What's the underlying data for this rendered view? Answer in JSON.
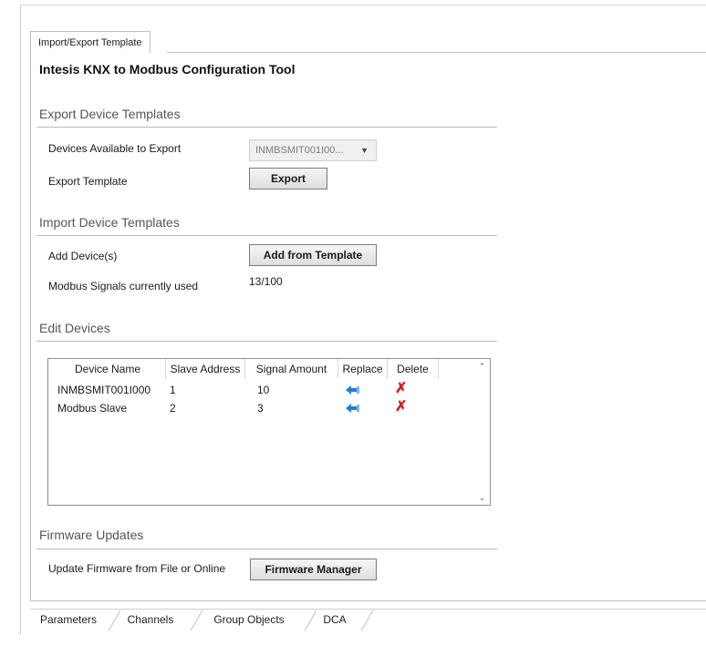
{
  "top_tab": {
    "label": "Import/Export Template"
  },
  "app_title": "Intesis KNX to Modbus Configuration Tool",
  "export_section": {
    "title": "Export Device Templates",
    "devices_label": "Devices Available to Export",
    "devices_selected": "INMBSMIT001I00...",
    "export_label": "Export Template",
    "export_button": "Export"
  },
  "import_section": {
    "title": "Import Device Templates",
    "add_label": "Add Device(s)",
    "add_button": "Add from Template",
    "signals_label": "Modbus Signals currently used",
    "signals_value": "13/100"
  },
  "edit_section": {
    "title": "Edit Devices",
    "columns": [
      "Device Name",
      "Slave Address",
      "Signal Amount",
      "Replace",
      "Delete"
    ],
    "rows": [
      {
        "device_name": "INMBSMIT001I000",
        "slave_address": "1",
        "signal_amount": "10",
        "replace_icon": "replace-arrow-icon",
        "delete_icon": "delete-x-icon"
      },
      {
        "device_name": "Modbus Slave",
        "slave_address": "2",
        "signal_amount": "3",
        "replace_icon": "replace-arrow-icon",
        "delete_icon": "delete-x-icon"
      }
    ]
  },
  "firmware_section": {
    "title": "Firmware Updates",
    "update_label": "Update Firmware from File or Online",
    "manager_button": "Firmware Manager"
  },
  "bottom_tabs": [
    "Parameters",
    "Channels",
    "Group Objects",
    "DCA"
  ],
  "colors": {
    "delete": "#d01f1f",
    "replace": "#1e7fd6",
    "section_title": "#555555"
  }
}
